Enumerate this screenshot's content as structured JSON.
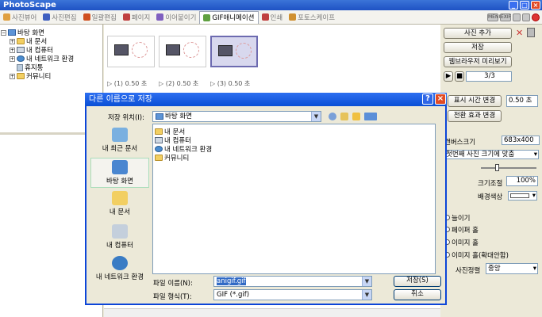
{
  "app": {
    "title": "PhotoScape"
  },
  "tabs": [
    {
      "label": "사진뷰어",
      "color": "#e0a040"
    },
    {
      "label": "사진편집",
      "color": "#4060c0"
    },
    {
      "label": "일괄편집",
      "color": "#d05020"
    },
    {
      "label": "페이지",
      "color": "#c04040"
    },
    {
      "label": "이어붙이기",
      "color": "#8060c0"
    },
    {
      "label": "GIF애니메이션",
      "color": "#60a040"
    },
    {
      "label": "인쇄",
      "color": "#c04040"
    },
    {
      "label": "포토스케이프",
      "color": "#d09030"
    }
  ],
  "toolbar_right": [
    "MENU",
    "EXIF"
  ],
  "tree": [
    {
      "label": "바탕 화면",
      "icon": "desktop-icon"
    },
    {
      "label": "내 문서",
      "icon": "folder-icon"
    },
    {
      "label": "내 컴퓨터",
      "icon": "computer-icon"
    },
    {
      "label": "내 네트워크 환경",
      "icon": "network-icon"
    },
    {
      "label": "휴지통",
      "icon": "trash-icon"
    },
    {
      "label": "커뮤니티",
      "icon": "folder-icon"
    }
  ],
  "frames": [
    {
      "label": "▷ (1) 0.50 초"
    },
    {
      "label": "▷ (2) 0.50 초"
    },
    {
      "label": "▷ (3) 0.50 초"
    }
  ],
  "right": {
    "add_photo": "사진 추가",
    "save": "저장",
    "preview_browser": "웹브라우저 미리보기",
    "frame_counter": "3/3",
    "change_time": "표시 시간 변경",
    "time_value": "0.50 초",
    "change_effect": "전환 효과 변경",
    "canvas_size_label": "캔버스크기",
    "canvas_size_value": "683x400",
    "fit_option": "첫번째 사진 크기에 맞춤",
    "scale_label": "크기조절",
    "scale_value": "100%",
    "bg_color_label": "배경색상",
    "radios": [
      "늘이기",
      "페이퍼 홀",
      "이미지 홀",
      "이미지 홀(확대안함)"
    ],
    "align_label": "사진정렬",
    "align_value": "중앙"
  },
  "dialog": {
    "title": "다른 이름으로 저장",
    "save_in_label": "저장 위치(I):",
    "save_in_value": "바탕 화면",
    "places": [
      "내 최근 문서",
      "바탕 화면",
      "내 문서",
      "내 컴퓨터",
      "내 네트워크 환경"
    ],
    "files": [
      "내 문서",
      "내 컴퓨터",
      "내 네트워크 환경",
      "커뮤니티"
    ],
    "filename_label": "파일 이름(N):",
    "filename_value": "anigif.gif",
    "filetype_label": "파일 형식(T):",
    "filetype_value": "GIF (*.gif)",
    "save_button": "저장(S)",
    "cancel_button": "취소"
  }
}
